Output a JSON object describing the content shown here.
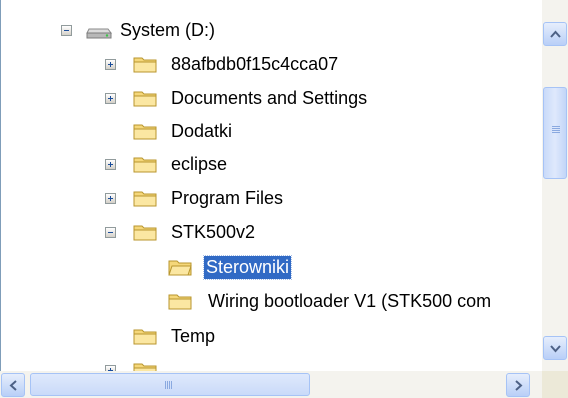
{
  "tree": {
    "drive": {
      "label": "System (D:)",
      "icon": "hard-drive-icon"
    },
    "items": [
      {
        "label": "88afbdb0f15c4cca07",
        "expander": "plus"
      },
      {
        "label": "Documents and Settings",
        "expander": "plus"
      },
      {
        "label": "Dodatki",
        "expander": "none"
      },
      {
        "label": "eclipse",
        "expander": "plus"
      },
      {
        "label": "Program Files",
        "expander": "plus"
      },
      {
        "label": "STK500v2",
        "expander": "minus"
      },
      {
        "label": "Sterowniki",
        "expander": "none",
        "selected": true
      },
      {
        "label": "Wiring bootloader V1 (STK500 com",
        "expander": "none"
      },
      {
        "label": "Temp",
        "expander": "none"
      }
    ]
  },
  "colors": {
    "selection": "#316ac5",
    "folder": "#f5d77a"
  }
}
